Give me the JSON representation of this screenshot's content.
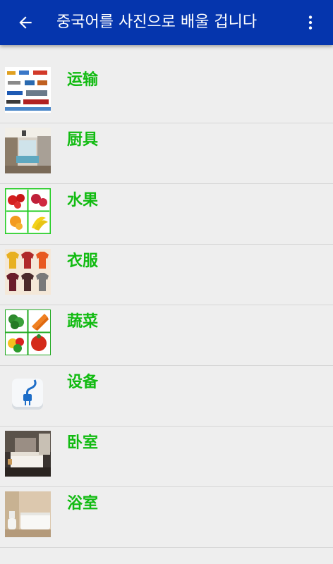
{
  "app_bar": {
    "title": "중국어를 사진으로 배울 겁니다",
    "back_icon": "arrow-back-icon",
    "menu_icon": "more-vert-icon",
    "color": "#0535ad"
  },
  "categories": [
    {
      "label": "运输",
      "icon": "transport-thumbnail"
    },
    {
      "label": "厨具",
      "icon": "kitchen-thumbnail"
    },
    {
      "label": "水果",
      "icon": "fruit-thumbnail"
    },
    {
      "label": "衣服",
      "icon": "clothes-thumbnail"
    },
    {
      "label": "蔬菜",
      "icon": "vegetables-thumbnail"
    },
    {
      "label": "设备",
      "icon": "plug-thumbnail"
    },
    {
      "label": "卧室",
      "icon": "bedroom-thumbnail"
    },
    {
      "label": "浴室",
      "icon": "bathroom-thumbnail"
    }
  ],
  "label_color": "#11bb11"
}
